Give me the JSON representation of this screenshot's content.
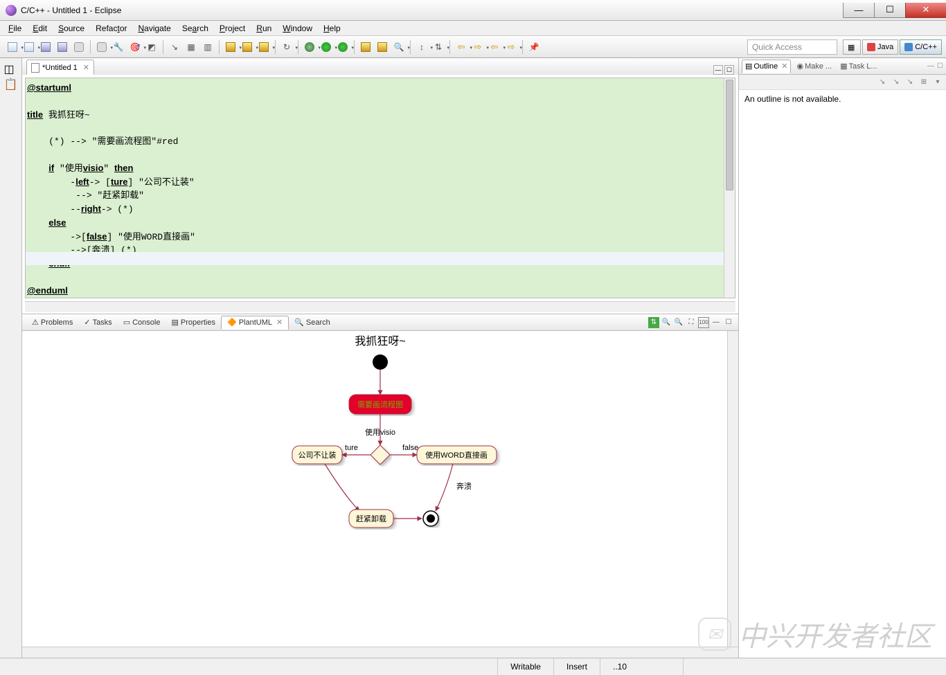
{
  "titlebar": {
    "text": "C/C++ - Untitled 1 - Eclipse"
  },
  "menu": {
    "items": [
      "File",
      "Edit",
      "Source",
      "Refactor",
      "Navigate",
      "Search",
      "Project",
      "Run",
      "Window",
      "Help"
    ]
  },
  "quick_access": {
    "placeholder": "Quick Access"
  },
  "perspectives": {
    "java": "Java",
    "cpp": "C/C++"
  },
  "editor": {
    "tab": "*Untitled 1",
    "code": "@startuml\n\ntitle 我抓狂呀~\n\n    (*) --> \"需要画流程图\"#red\n\n    if \"使用visio\" then\n        -left-> [ture] \"公司不让装\"\n         --> \"赶紧卸载\"\n        --right-> (*)\n    else\n        ->[false] \"使用WORD直接画\"\n        -->[奔溃] (*)\n    endif\n\n@enduml"
  },
  "bottom_tabs": {
    "problems": "Problems",
    "tasks": "Tasks",
    "console": "Console",
    "properties": "Properties",
    "plantuml": "PlantUML",
    "search": "Search"
  },
  "outline": {
    "tab": "Outline",
    "make": "Make ...",
    "tasklist": "Task L...",
    "empty": "An outline is not available."
  },
  "status": {
    "writable": "Writable",
    "insert": "Insert",
    "pos": "10"
  },
  "watermark": "中兴开发者社区",
  "diagram": {
    "title": "我抓狂呀~",
    "n1": "需要画流程图",
    "cond": "使用visio",
    "t": "ture",
    "f": "false",
    "n2": "公司不让装",
    "n3": "使用WORD直接画",
    "n4": "赶紧卸载",
    "b1": "奔溃"
  }
}
